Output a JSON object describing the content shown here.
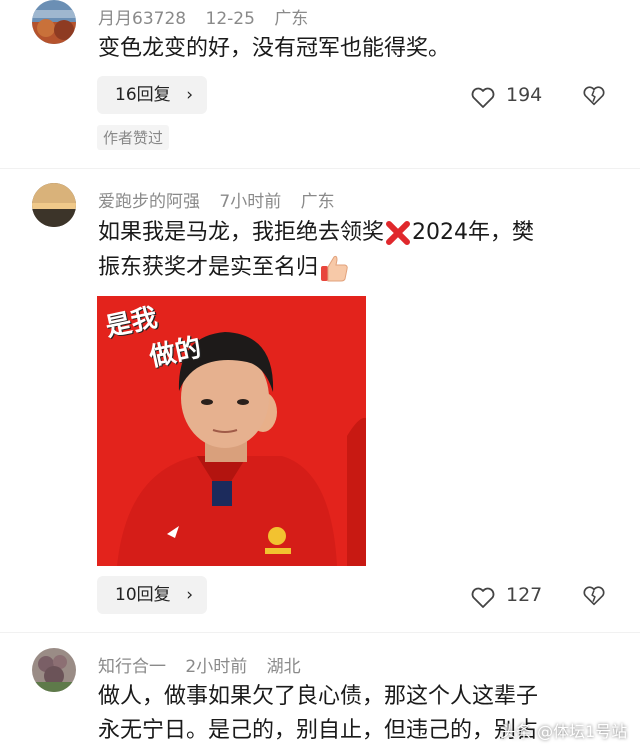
{
  "comments": [
    {
      "username": "月月63728",
      "date": "12-25",
      "location": "广东",
      "text_lines": [
        "变色龙变的好，没有冠军也能得奖。"
      ],
      "reply_label": "16回复",
      "like_count": "194",
      "author_badge": "作者赞过"
    },
    {
      "username": "爱跑步的阿强",
      "date": "7小时前",
      "location": "广东",
      "text_line1_a": "如果我是马龙，我拒绝去领奖",
      "text_line1_b": "2024年，樊",
      "text_line2": "振东获奖才是实至名归",
      "image_caption_1": "是我",
      "image_caption_2": "做的",
      "reply_label": "10回复",
      "like_count": "127"
    },
    {
      "username": "知行合一",
      "date": "2小时前",
      "location": "湖北",
      "text_lines": [
        "做人，做事如果欠了良心债，那这个人这辈子",
        "永无宁日。是己的，别自止，但违己的，别占"
      ]
    }
  ],
  "watermark": "头条 @体坛1号站",
  "icons": {
    "like": "heart-outline-icon",
    "dislike": "broken-heart-icon",
    "chevron": "chevron-right-icon",
    "cross": "red-cross-emoji-icon",
    "thumb": "thumbs-up-emoji-icon"
  }
}
